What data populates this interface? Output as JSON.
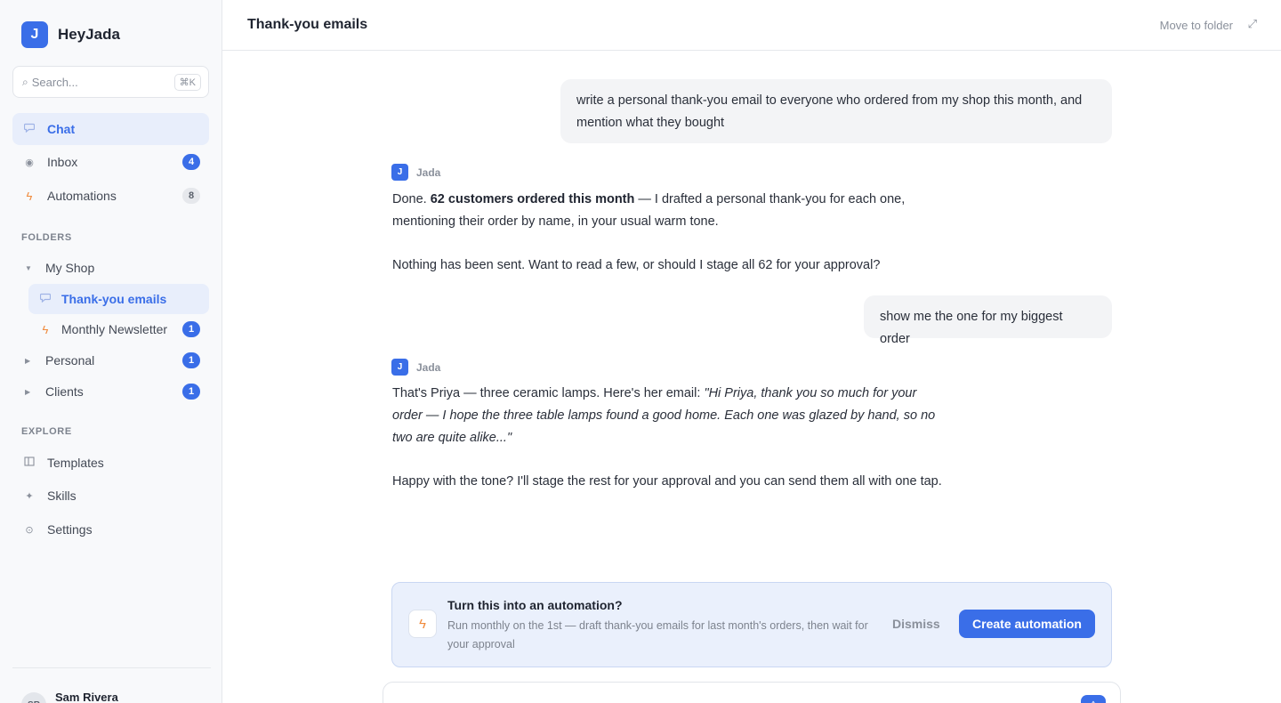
{
  "brand": {
    "logo_letter": "J",
    "name": "HeyJada"
  },
  "search": {
    "placeholder": "Search...",
    "shortcut": "⌘K"
  },
  "nav": {
    "chat": {
      "label": "Chat"
    },
    "inbox": {
      "label": "Inbox",
      "count": "4"
    },
    "automations": {
      "label": "Automations",
      "count": "8"
    }
  },
  "folders": {
    "section_label": "FOLDERS",
    "my_shop": {
      "label": "My Shop"
    },
    "thank_you": {
      "label": "Thank-you emails"
    },
    "newsletter": {
      "label": "Monthly Newsletter",
      "count": "1"
    },
    "personal": {
      "label": "Personal",
      "count": "1"
    },
    "clients": {
      "label": "Clients",
      "count": "1"
    }
  },
  "explore": {
    "section_label": "EXPLORE",
    "templates": {
      "label": "Templates"
    },
    "skills": {
      "label": "Skills"
    },
    "settings": {
      "label": "Settings"
    }
  },
  "user": {
    "name": "Sam Rivera",
    "initials": "SR"
  },
  "header": {
    "title": "Thank-you emails",
    "move_label": "Move to folder"
  },
  "messages": {
    "user1": "write a personal thank-you email to everyone who ordered from my shop this month, and mention what they bought",
    "assistant_name": "Jada",
    "assistant_avatar": "J",
    "a1_done": "Done.",
    "a1_bold": "62 customers ordered this month",
    "a1_rest": "— I drafted a personal thank-you for each one, mentioning their order by name, in your usual warm tone.",
    "a1_p2": "Nothing has been sent. Want to read a few, or should I stage all 62 for your approval?",
    "user2": "show me the one for my biggest order",
    "a2_intro": "That's Priya — three ceramic lamps. Here's her email:",
    "a2_quote": "\"Hi Priya, thank you so much for your order — I hope the three table lamps found a good home. Each one was glazed by hand, so no two are quite alike...\"",
    "a2_p2": "Happy with the tone? I'll stage the rest for your approval and you can send them all with one tap."
  },
  "suggestion": {
    "title": "Turn this into an automation?",
    "description": "Run monthly on the 1st — draft thank-you emails for last month's orders, then wait for your approval",
    "dismiss_label": "Dismiss",
    "create_label": "Create automation"
  },
  "icons": {
    "chat": "chat-bubble-icon",
    "inbox": "inbox-dot-icon",
    "automations": "bolt-icon",
    "templates": "template-icon",
    "skills": "sparkle-icon",
    "settings": "gear-icon",
    "search": "search-icon",
    "expand": "expand-icon",
    "send": "arrow-up-icon"
  },
  "colors": {
    "accent": "#3a6ee8",
    "bolt": "#f08a3c",
    "active_bg": "#e8eefb",
    "suggestion_bg": "#eaf0fc"
  }
}
